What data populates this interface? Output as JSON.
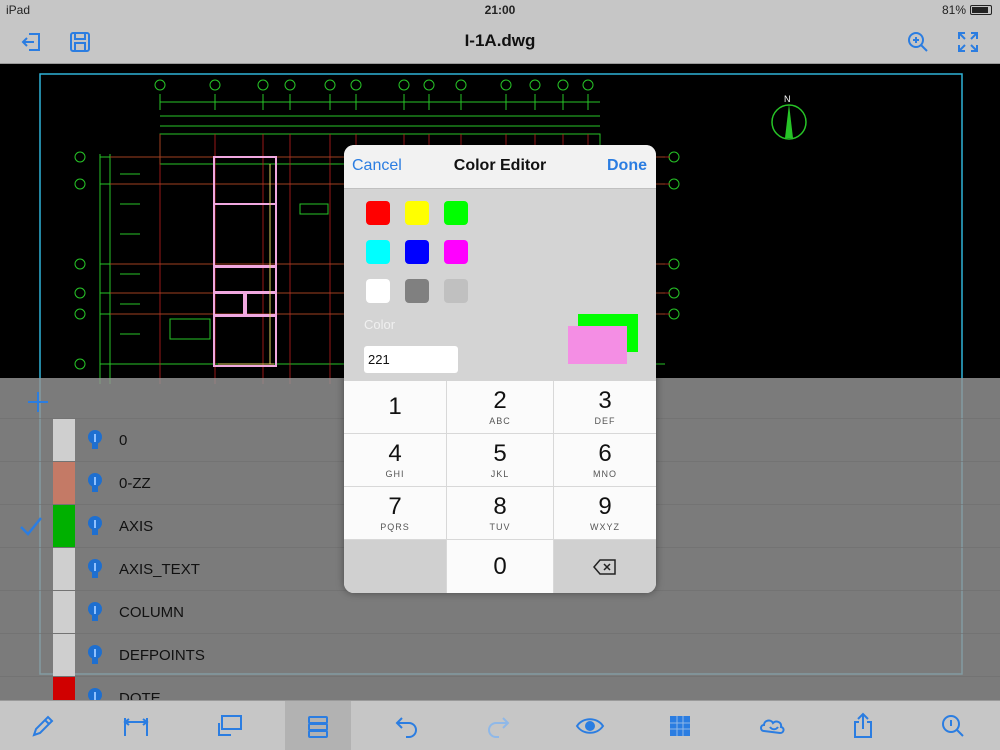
{
  "status_bar": {
    "device": "iPad",
    "time": "21:00",
    "battery": "81%"
  },
  "document": {
    "title": "I-1A.dwg"
  },
  "color_editor": {
    "title": "Color Editor",
    "cancel_label": "Cancel",
    "done_label": "Done",
    "color_label": "Color",
    "color_value": "221",
    "preset_colors": [
      "#ff0000",
      "#ffff00",
      "#00ff00",
      "#00ffff",
      "#0000ff",
      "#ff00ff",
      "#ffffff",
      "#808080",
      "#c0c0c0"
    ],
    "old_color": "#00ff00",
    "new_color": "#f48ee4"
  },
  "keypad": [
    {
      "num": "1",
      "letters": ""
    },
    {
      "num": "2",
      "letters": "ABC"
    },
    {
      "num": "3",
      "letters": "DEF"
    },
    {
      "num": "4",
      "letters": "GHI"
    },
    {
      "num": "5",
      "letters": "JKL"
    },
    {
      "num": "6",
      "letters": "MNO"
    },
    {
      "num": "7",
      "letters": "PQRS"
    },
    {
      "num": "8",
      "letters": "TUV"
    },
    {
      "num": "9",
      "letters": "WXYZ"
    },
    {
      "num": "0",
      "letters": ""
    }
  ],
  "layers": [
    {
      "name": "0",
      "color": "#cfcfcf",
      "checked": false
    },
    {
      "name": "0-ZZ",
      "color": "#c47a66",
      "checked": false
    },
    {
      "name": "AXIS",
      "color": "#00b000",
      "checked": true
    },
    {
      "name": "AXIS_TEXT",
      "color": "#cfcfcf",
      "checked": false
    },
    {
      "name": "COLUMN",
      "color": "#cfcfcf",
      "checked": false
    },
    {
      "name": "DEFPOINTS",
      "color": "#cfcfcf",
      "checked": false
    },
    {
      "name": "DOTE",
      "color": "#d00000",
      "checked": false
    }
  ],
  "toolbar": {
    "items": [
      "pencil-icon",
      "dimension-icon",
      "markup-icon",
      "layers-icon",
      "undo-icon",
      "redo-icon",
      "eye-icon",
      "grid-icon",
      "cloud-icon",
      "share-icon",
      "zoom-icon"
    ],
    "active_item": "layers-icon"
  },
  "accent_color": "#2b7de1"
}
